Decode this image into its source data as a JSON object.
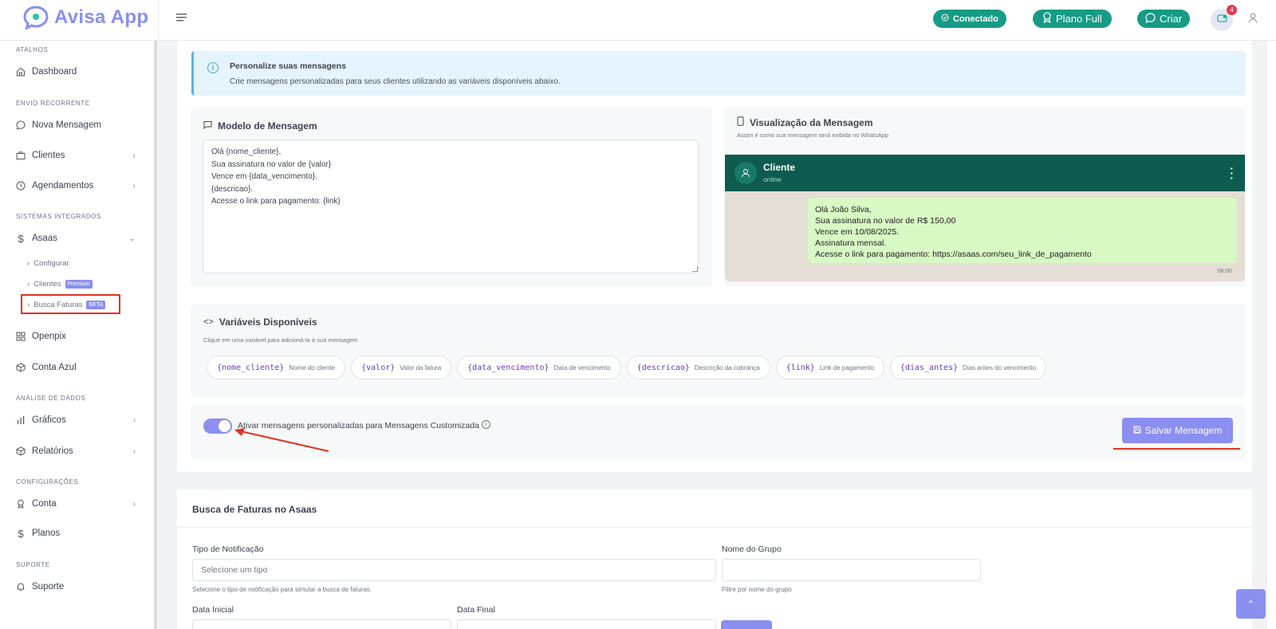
{
  "app": {
    "name": "Avisa App"
  },
  "topbar": {
    "status": "Conectado",
    "plan": "Plano Full",
    "create": "Criar",
    "notifications": "4"
  },
  "sidebar": {
    "sections": {
      "atalhos": "ATALHOS",
      "envio": "ENVIO RECORRENTE",
      "sistemas": "SISTEMAS INTEGRADOS",
      "analise": "ANÁLISE DE DADOS",
      "config": "CONFIGURAÇÕES",
      "suporte": "SUPORTE"
    },
    "items": {
      "dashboard": "Dashboard",
      "nova_mensagem": "Nova Mensagem",
      "clientes": "Clientes",
      "agendamentos": "Agendamentos",
      "asaas": "Asaas",
      "configurar": "Configurar",
      "clientes_sub": "Clientes",
      "premium": "Premium",
      "busca_faturas": "Busca Faturas",
      "beta": "BETA",
      "openpix": "Openpix",
      "conta_azul": "Conta Azul",
      "graficos": "Gráficos",
      "relatorios": "Relatórios",
      "conta": "Conta",
      "planos": "Planos",
      "suporte": "Suporte"
    }
  },
  "info": {
    "title": "Personalize suas mensagens",
    "desc": "Crie mensagens personalizadas para seus clientes utilizando as variáveis disponíveis abaixo."
  },
  "modelo": {
    "title": "Modelo de Mensagem",
    "text": "Olá {nome_cliente},\nSua assinatura no valor de {valor}\nVence em {data_vencimento}.\n{descricao}.\nAcesse o link para pagamento: {link}"
  },
  "visual": {
    "title": "Visualização da Mensagem",
    "subtitle": "Assim é como sua mensagem será exibida no WhatsApp",
    "contact": "Cliente",
    "status": "online",
    "message": "Olá João Silva,\nSua assinatura no valor de R$ 150,00\nVence em 10/08/2025.\nAssinatura mensal.\nAcesse o link para pagamento: https://asaas.com/seu_link_de_pagamento",
    "time": "08:00"
  },
  "variaveis": {
    "title": "Variáveis Disponíveis",
    "subtitle": "Clique em uma variável para adicioná-la à sua mensagem",
    "chips": [
      {
        "code": "{nome_cliente}",
        "desc": "Nome do cliente"
      },
      {
        "code": "{valor}",
        "desc": "Valor da fatura"
      },
      {
        "code": "{data_vencimento}",
        "desc": "Data de vencimento"
      },
      {
        "code": "{descricao}",
        "desc": "Descrição da cobrança"
      },
      {
        "code": "{link}",
        "desc": "Link de pagamento"
      },
      {
        "code": "{dias_antes}",
        "desc": "Dias antes do vencimento"
      }
    ]
  },
  "toggle": {
    "label": "Ativar mensagens personalizadas para Mensagens Customizada",
    "enabled": true
  },
  "save_button": "Salvar Mensagem",
  "busca": {
    "title": "Busca de Faturas no Asaas",
    "tipo_label": "Tipo de Notificação",
    "tipo_placeholder": "Selecione um tipo",
    "tipo_help": "Selecione o tipo de notificação para simular a busca de faturas.",
    "grupo_label": "Nome do Grupo",
    "grupo_help": "Filtre por nome do grupo",
    "data_inicial": "Data Inicial",
    "data_final": "Data Final"
  },
  "colors": {
    "accent": "#8b8ff0",
    "whatsapp_header": "#0d5c4f",
    "bubble": "#d8f8c4",
    "status_green": "#169b86",
    "annotation_red": "#e0331f"
  }
}
